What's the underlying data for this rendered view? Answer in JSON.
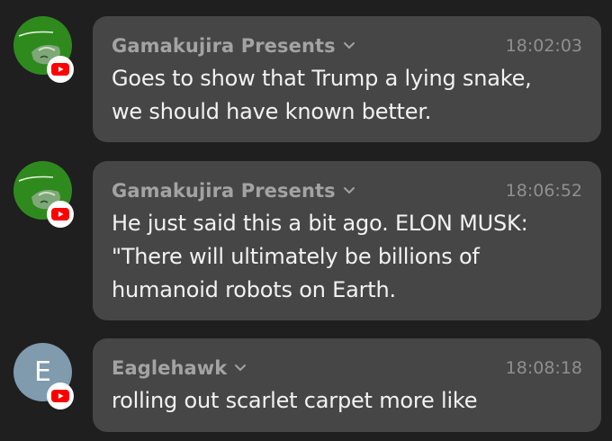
{
  "messages": [
    {
      "author": "Gamakujira Presents",
      "time": "18:02:03",
      "lines": [
        "Goes to show that Trump a lying snake,",
        "we should have known better."
      ],
      "avatar": {
        "type": "image",
        "icon": "gamakujira-avatar"
      },
      "badge_icon": "youtube-icon"
    },
    {
      "author": "Gamakujira Presents",
      "time": "18:06:52",
      "lines": [
        "He just said this a bit ago. ELON MUSK:",
        "\"There will ultimately be billions of",
        "humanoid robots on Earth."
      ],
      "avatar": {
        "type": "image",
        "icon": "gamakujira-avatar"
      },
      "badge_icon": "youtube-icon"
    },
    {
      "author": "Eaglehawk",
      "time": "18:08:18",
      "lines": [
        "rolling out scarlet carpet more like"
      ],
      "avatar": {
        "type": "letter",
        "letter": "E"
      },
      "badge_icon": "youtube-icon"
    }
  ],
  "colors": {
    "background": "#1f1f1f",
    "bubble": "#464646",
    "author": "#a3a3a3",
    "time": "#8f8f8f",
    "text": "#f2f2f2",
    "letter_avatar": "#7f9bad",
    "youtube_red": "#ff0000"
  }
}
